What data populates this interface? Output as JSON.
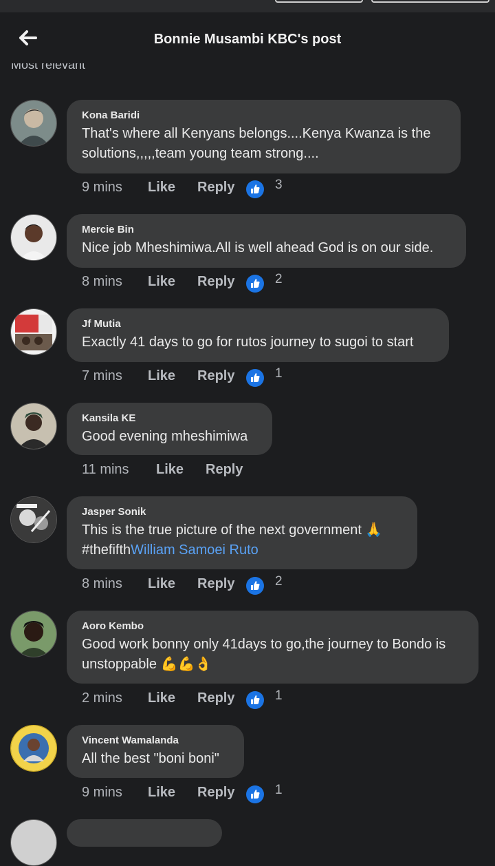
{
  "header": {
    "title": "Bonnie Musambi KBC's post",
    "sort_label": "Most relevant"
  },
  "comments": [
    {
      "name": "Kona Baridi",
      "text": "That's where all Kenyans belongs....Kenya Kwanza is the solutions,,,,,team young team strong....",
      "time": "9 mins",
      "like": "Like",
      "reply": "Reply",
      "reactions": "3"
    },
    {
      "name": "Mercie Bin",
      "text": "Nice job Mheshimiwa.All is well ahead God is on our side.",
      "time": "8 mins",
      "like": "Like",
      "reply": "Reply",
      "reactions": "2"
    },
    {
      "name": "Jf Mutia",
      "text": "Exactly 41 days to go for rutos journey to sugoi to start",
      "time": "7 mins",
      "like": "Like",
      "reply": "Reply",
      "reactions": "1"
    },
    {
      "name": "Kansila KE",
      "text": "Good evening mheshimiwa",
      "time": "11 mins",
      "like": "Like",
      "reply": "Reply",
      "reactions": ""
    },
    {
      "name": "Jasper Sonik",
      "text": "This is the true picture of the next government 🙏",
      "text2": "#thefifth",
      "link": "William Samoei Ruto",
      "time": "8 mins",
      "like": "Like",
      "reply": "Reply",
      "reactions": "2"
    },
    {
      "name": "Aoro Kembo",
      "text": "Good work bonny only 41days to go,the journey to Bondo is unstoppable",
      "emoji": "💪💪👌",
      "time": "2 mins",
      "like": "Like",
      "reply": "Reply",
      "reactions": "1"
    },
    {
      "name": "Vincent Wamalanda",
      "text": "All the best \"boni boni\"",
      "time": "9 mins",
      "like": "Like",
      "reply": "Reply",
      "reactions": "1"
    }
  ],
  "colors": {
    "background": "#1c1d1f",
    "bubble": "#3a3b3c",
    "link": "#5aa2f5",
    "like_badge": "#1b74e4"
  }
}
